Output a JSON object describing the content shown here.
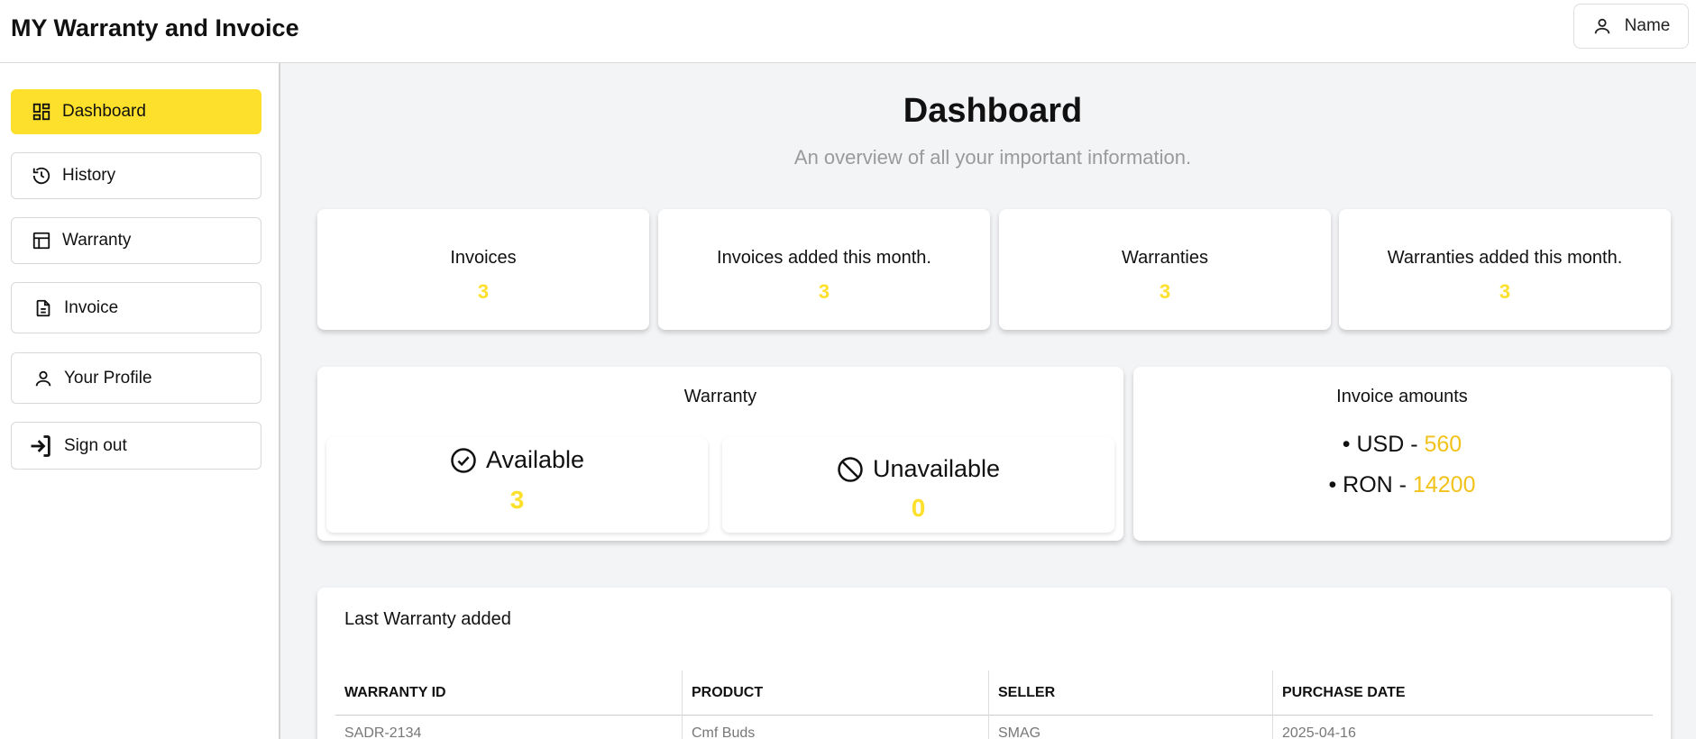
{
  "app": {
    "title": "MY Warranty and Invoice"
  },
  "header": {
    "user_name": "Name"
  },
  "sidebar": {
    "items": [
      {
        "label": "Dashboard",
        "icon": "dashboard-icon",
        "active": true
      },
      {
        "label": "History",
        "icon": "history-icon"
      },
      {
        "label": "Warranty",
        "icon": "warranty-icon"
      },
      {
        "label": "Invoice",
        "icon": "invoice-icon"
      },
      {
        "label": "Your Profile",
        "icon": "user-icon"
      },
      {
        "label": "Sign out",
        "icon": "sign-out-icon"
      }
    ]
  },
  "dashboard": {
    "title": "Dashboard",
    "subtitle": "An overview of all your important information.",
    "stats": [
      {
        "label": "Invoices",
        "value": "3"
      },
      {
        "label": "Invoices added this month.",
        "value": "3"
      },
      {
        "label": "Warranties",
        "value": "3"
      },
      {
        "label": "Warranties added this month.",
        "value": "3"
      }
    ],
    "warranty": {
      "title": "Warranty",
      "available_label": "Available",
      "available_value": "3",
      "unavailable_label": "Unavailable",
      "unavailable_value": "0"
    },
    "invoice_amounts": {
      "title": "Invoice amounts",
      "items": [
        {
          "currency": "• USD -",
          "amount": "560"
        },
        {
          "currency": "• RON -",
          "amount": "14200"
        }
      ]
    },
    "last_warranty": {
      "title": "Last Warranty added",
      "columns": [
        "WARRANTY ID",
        "PRODUCT",
        "SELLER",
        "PURCHASE DATE"
      ],
      "rows": [
        [
          "SADR-2134",
          "Cmf Buds",
          "SMAG",
          "2025-04-16"
        ]
      ]
    }
  },
  "colors": {
    "accent": "#fde02b",
    "amount": "#f2c21b"
  }
}
